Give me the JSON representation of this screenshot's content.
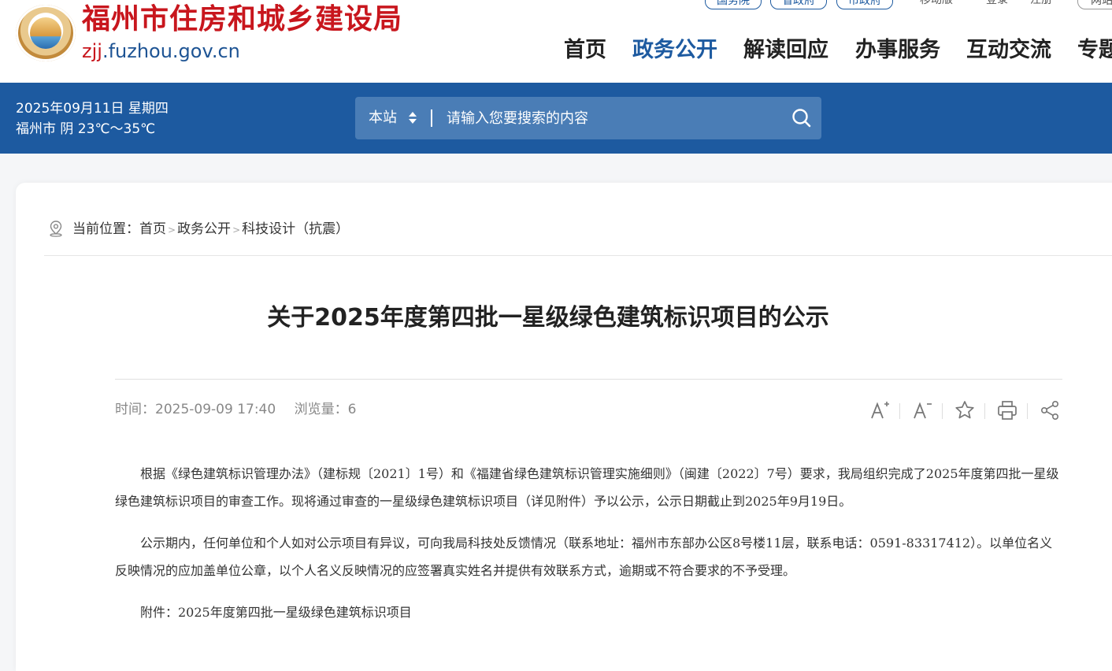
{
  "header": {
    "site_title": "福州市住房和城乡建设局",
    "domain_highlight": "zjj",
    "domain_rest": ".fuzhou.gov.cn",
    "top_links": [
      "国务院",
      "省政府",
      "市政府"
    ],
    "mobile": "移动版",
    "login": "登录",
    "divider": "·",
    "register": "注册",
    "network": "网站"
  },
  "nav": {
    "items": [
      "首页",
      "政务公开",
      "解读回应",
      "办事服务",
      "互动交流",
      "专题"
    ],
    "active": "政务公开"
  },
  "bar": {
    "date": "2025年09月11日 星期四",
    "weather": "福州市 阴 23℃～35℃"
  },
  "search": {
    "scope": "本站",
    "placeholder": "请输入您要搜索的内容"
  },
  "breadcrumb": {
    "label": "当前位置：",
    "items": [
      "首页",
      "政务公开",
      "科技设计（抗震）"
    ],
    "sep": ">"
  },
  "article": {
    "title": "关于2025年度第四批一星级绿色建筑标识项目的公示",
    "time": "时间：2025-09-09 17:40",
    "views": "浏览量：6",
    "paragraphs": [
      "根据《绿色建筑标识管理办法》（建标规〔2021〕1号）和《福建省绿色建筑标识管理实施细则》（闽建〔2022〕7号）要求，我局组织完成了2025年度第四批一星级绿色建筑标识项目的审查工作。现将通过审查的一星级绿色建筑标识项目（详见附件）予以公示，公示日期截止到2025年9月19日。",
      "公示期内，任何单位和个人如对公示项目有异议，可向我局科技处反馈情况（联系地址：福州市东部办公区8号楼11层，联系电话：0591-83317412）。以单位名义反映情况的应加盖单位公章，以个人名义反映情况的应签署真实姓名并提供有效联系方式，逾期或不符合要求的不予受理。",
      "附件：2025年度第四批一星级绿色建筑标识项目"
    ]
  },
  "colors": {
    "brand_blue": "#1d5aa0",
    "title_red": "#c8161d"
  }
}
